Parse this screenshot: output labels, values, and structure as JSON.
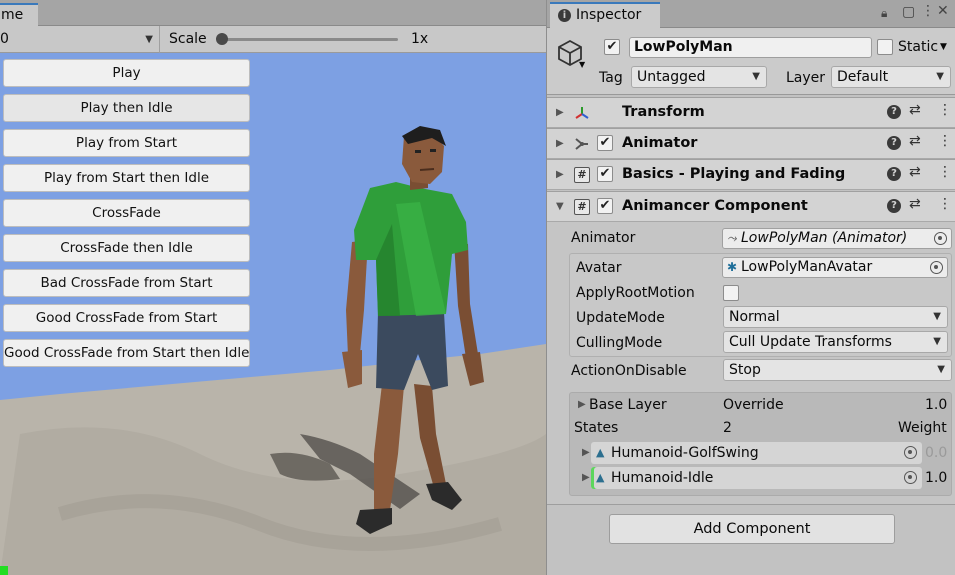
{
  "game": {
    "tab_label": "me",
    "display_value": "0",
    "scale_label": "Scale",
    "scale_value": "1x",
    "buttons": [
      "Play",
      "Play then Idle",
      "Play from Start",
      "Play from Start then Idle",
      "CrossFade",
      "CrossFade then Idle",
      "Bad CrossFade from Start",
      "Good CrossFade from Start",
      "Good CrossFade from Start then Idle"
    ]
  },
  "inspector": {
    "tab_label": "Inspector",
    "object": {
      "name": "LowPolyMan",
      "active": true,
      "static_label": "Static",
      "static_checked": false,
      "tag_label": "Tag",
      "tag_value": "Untagged",
      "layer_label": "Layer",
      "layer_value": "Default"
    },
    "components": [
      {
        "title": "Transform",
        "has_checkbox": false
      },
      {
        "title": "Animator",
        "has_checkbox": true
      },
      {
        "title": "Basics - Playing and Fading",
        "has_checkbox": true
      },
      {
        "title": "Animancer Component",
        "has_checkbox": true
      }
    ],
    "animancer": {
      "animator_label": "Animator",
      "animator_value": "LowPolyMan (Animator)",
      "avatar_label": "Avatar",
      "avatar_value": "LowPolyManAvatar",
      "apply_root_motion_label": "ApplyRootMotion",
      "apply_root_motion": false,
      "update_mode_label": "UpdateMode",
      "update_mode_value": "Normal",
      "culling_mode_label": "CullingMode",
      "culling_mode_value": "Cull Update Transforms",
      "action_on_disable_label": "ActionOnDisable",
      "action_on_disable_value": "Stop",
      "layer": {
        "name": "Base Layer",
        "blend": "Override",
        "weight_value": "1.0",
        "states_label": "States",
        "states_count": "2",
        "weight_label": "Weight",
        "states": [
          {
            "name": "Humanoid-GolfSwing",
            "weight": "0.0"
          },
          {
            "name": "Humanoid-Idle",
            "weight": "1.0"
          }
        ]
      }
    },
    "add_component_label": "Add Component"
  },
  "colors": {
    "sky": "#7da0e3",
    "shirt": "#2f9e3a",
    "shorts": "#3b4a5e",
    "skin": "#8a5a3c",
    "ground": "#b9b4aa",
    "accent_tab": "#3a79bb"
  },
  "icons": {
    "inspector_tab": "info-icon",
    "lock": "lock-icon",
    "maximize": "maximize-icon",
    "menu": "kebab-menu-icon",
    "game_object": "cube-icon",
    "transform": "transform-axes-icon",
    "animator": "animator-icon",
    "script": "script-hash-icon",
    "help": "help-icon",
    "presets": "presets-sliders-icon",
    "object_picker": "object-picker-target-icon",
    "avatar": "avatar-figure-icon",
    "animation_clip": "animation-clip-icon"
  }
}
